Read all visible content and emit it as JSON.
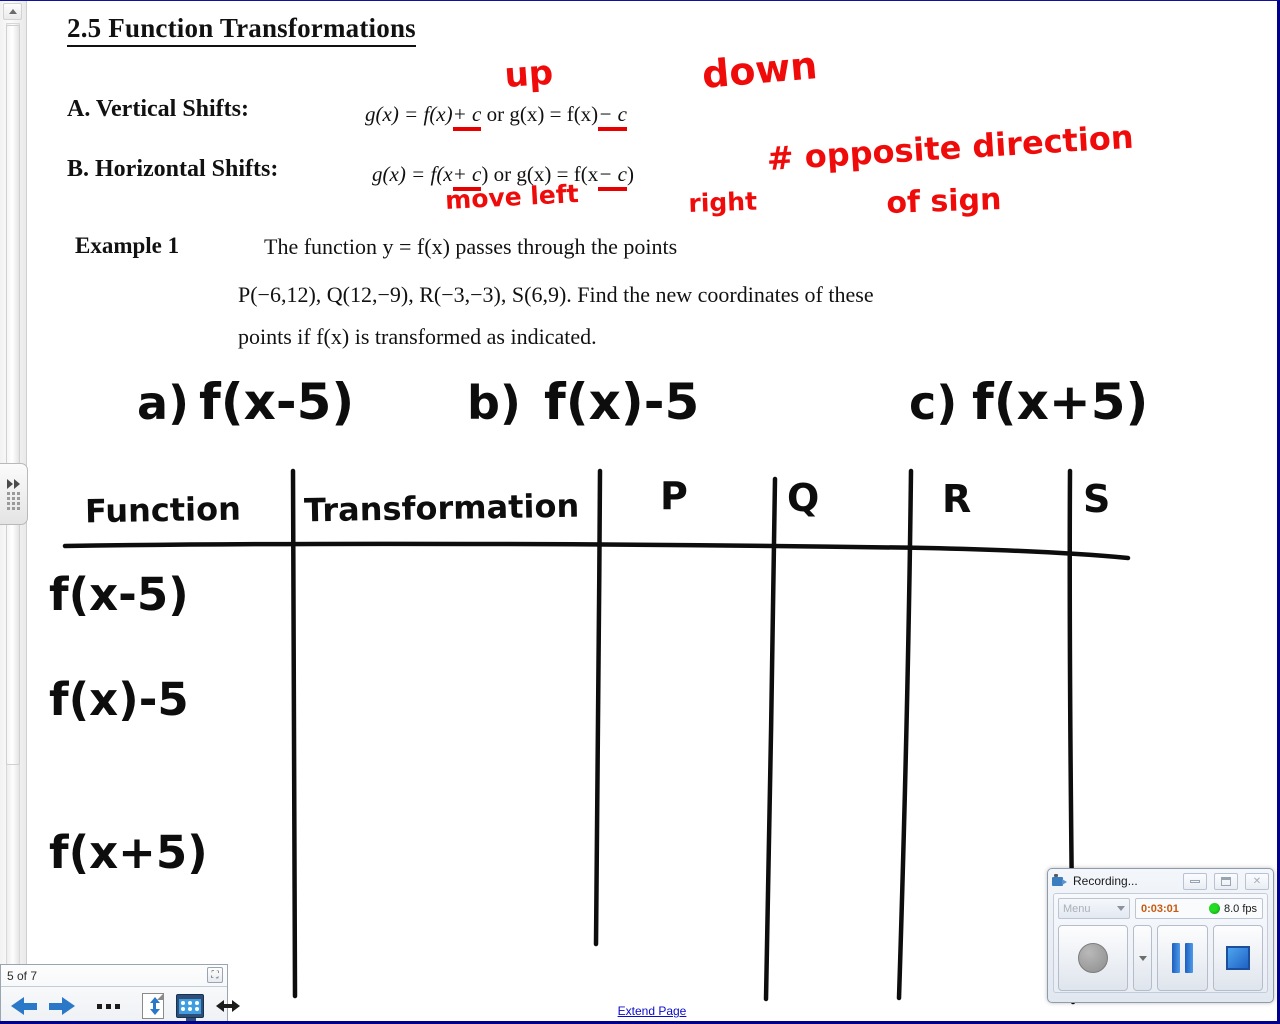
{
  "document": {
    "title": "2.5  Function Transformations",
    "sections": [
      {
        "label": "A.  Vertical Shifts:",
        "formula_pre": "g(x) = f(x)",
        "formula_op1": "+ c",
        "formula_mid": " or g(x) = f(x)",
        "formula_op2": "− c"
      },
      {
        "label": "B. Horizontal Shifts:",
        "formula_pre": "g(x) = f(x",
        "formula_op1": "+ c",
        "formula_mid": ") or g(x) = f(x",
        "formula_op2": "− c",
        "formula_post": ")"
      }
    ],
    "annotations": {
      "up": "up",
      "down": "down",
      "move_left": "move left",
      "right": "right",
      "opposite_1": "# opposite direction",
      "opposite_2": "of sign"
    },
    "example": {
      "label": "Example 1",
      "line1": "The function  y = f(x)  passes through the points",
      "line2": "P(−6,12), Q(12,−9), R(−3,−3), S(6,9).   Find the new coordinates of these",
      "line3": "points if  f(x)  is transformed as indicated."
    },
    "problems": [
      {
        "tag": "a)",
        "expr": "f(x-5)"
      },
      {
        "tag": "b)",
        "expr": "f(x)-5"
      },
      {
        "tag": "c)",
        "expr": "f(x+5)"
      }
    ],
    "table": {
      "headers": [
        "Function",
        "Transformation",
        "P",
        "Q",
        "R",
        "S"
      ],
      "rows": [
        {
          "function": "f(x-5)",
          "transformation": "",
          "P": "",
          "Q": "",
          "R": "",
          "S": ""
        },
        {
          "function": "f(x)-5",
          "transformation": "",
          "P": "",
          "Q": "",
          "R": "",
          "S": ""
        },
        {
          "function": "f(x+5)",
          "transformation": "",
          "P": "",
          "Q": "",
          "R": "",
          "S": ""
        }
      ]
    },
    "extend_page_link": "Extend Page"
  },
  "page_nav": {
    "page_count": "5 of 7",
    "close_label": "⛶",
    "prev_label": "previous-page",
    "next_label": "next-page"
  },
  "recorder": {
    "title": "Recording...",
    "menu_label": "Menu",
    "time": "0:03:01",
    "fps": "8.0 fps",
    "status_color": "#22dd22",
    "time_color": "#c85a10"
  },
  "colors": {
    "annotation_red": "#f00b0b",
    "link_blue": "#0b0bc8",
    "window_border": "#00008c",
    "accent_blue": "#2c78c8"
  }
}
